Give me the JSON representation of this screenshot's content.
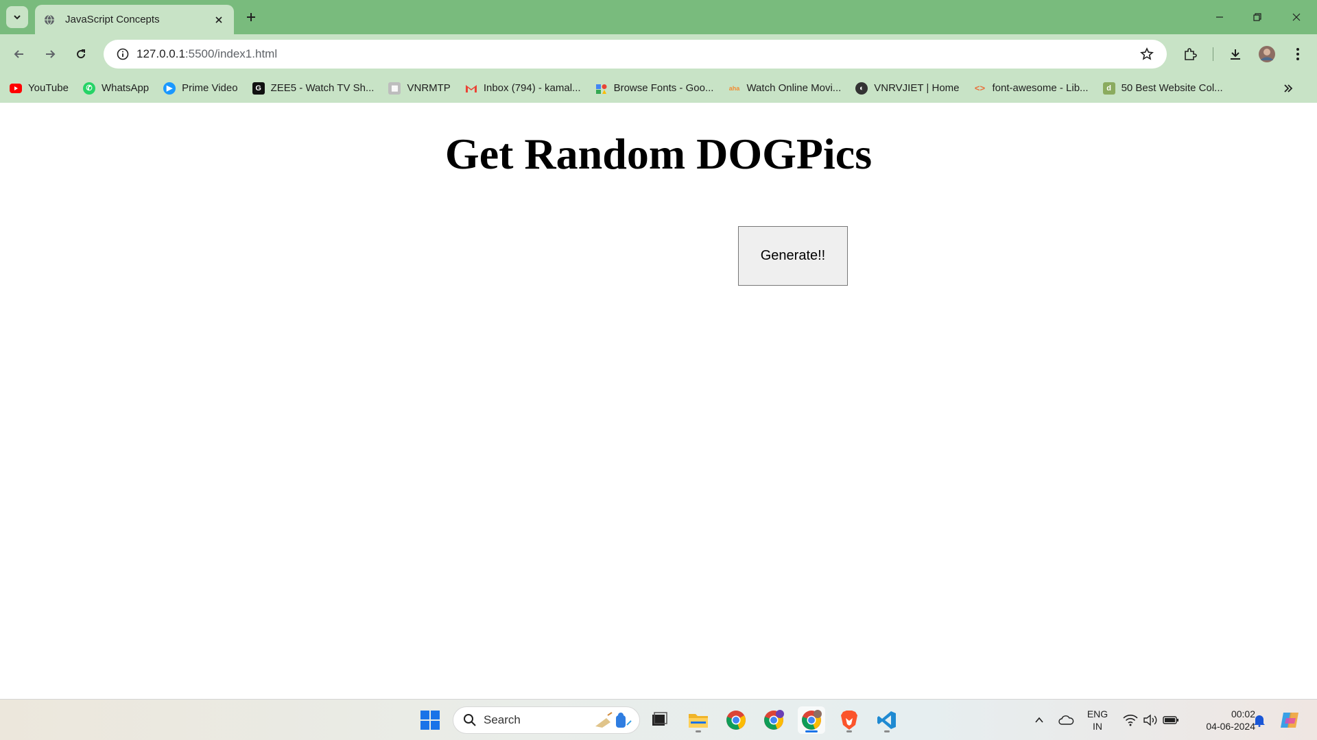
{
  "browser": {
    "tab": {
      "title": "JavaScript Concepts"
    },
    "url": {
      "host": "127.0.0.1",
      "path": ":5500/index1.html"
    },
    "bookmarks": [
      {
        "label": "YouTube",
        "icon": "youtube-icon",
        "color": "#ff0000"
      },
      {
        "label": "WhatsApp",
        "icon": "whatsapp-icon",
        "color": "#25d366"
      },
      {
        "label": "Prime Video",
        "icon": "prime-video-icon",
        "color": "#1a98ff"
      },
      {
        "label": "ZEE5 - Watch TV Sh...",
        "icon": "zee5-icon",
        "color": "#111111"
      },
      {
        "label": "VNRMTP",
        "icon": "vnrmtp-icon",
        "color": "#9e9e9e"
      },
      {
        "label": "Inbox (794) - kamal...",
        "icon": "gmail-icon",
        "color": "#ea4335"
      },
      {
        "label": "Browse Fonts - Goo...",
        "icon": "google-fonts-icon",
        "color": "#4285f4"
      },
      {
        "label": "Watch Online Movi...",
        "icon": "movies-site-icon",
        "color": "#f28b30"
      },
      {
        "label": "VNRVJIET | Home",
        "icon": "vnrvjiet-icon",
        "color": "#333333"
      },
      {
        "label": "font-awesome - Lib...",
        "icon": "code-brackets-icon",
        "color": "#e8713c"
      },
      {
        "label": "50 Best Website Col...",
        "icon": "website-colors-icon",
        "color": "#8bab5f"
      }
    ]
  },
  "page": {
    "heading": "Get Random DOGPics",
    "button_label": "Generate!!"
  },
  "taskbar": {
    "search_placeholder": "Search",
    "lang_line1": "ENG",
    "lang_line2": "IN",
    "time": "00:02",
    "date": "04-06-2024"
  }
}
